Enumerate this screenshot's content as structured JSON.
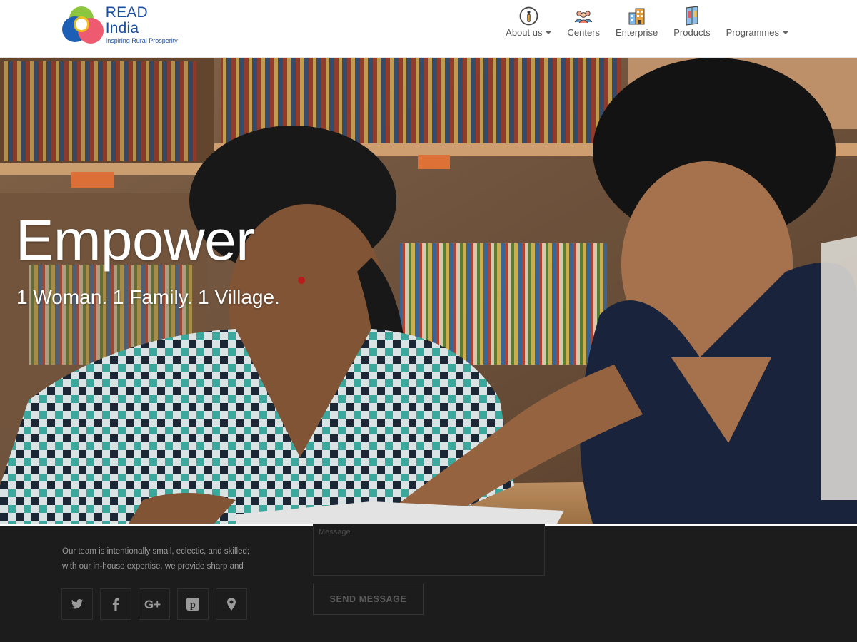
{
  "brand": {
    "name": "READ India",
    "tagline": "Inspiring Rural Prosperity"
  },
  "nav": {
    "items": [
      {
        "label": "About us",
        "icon": "info-icon",
        "dropdown": true
      },
      {
        "label": "Centers",
        "icon": "people-icon",
        "dropdown": false
      },
      {
        "label": "Enterprise",
        "icon": "buildings-icon",
        "dropdown": false
      },
      {
        "label": "Products",
        "icon": "book-icon",
        "dropdown": false
      },
      {
        "label": "Programmes",
        "icon": "",
        "dropdown": true
      }
    ]
  },
  "hero": {
    "title": "Empower",
    "subtitle": "1 Woman. 1 Family. 1 Village."
  },
  "footer": {
    "about_line1": "Our team is intentionally small, eclectic, and skilled;",
    "about_line2": "with our in-house expertise, we provide sharp and",
    "message_placeholder": "Message",
    "send_label": "SEND MESSAGE",
    "socials": [
      "twitter-icon",
      "facebook-icon",
      "google-plus-icon",
      "pinterest-icon",
      "map-pin-icon"
    ]
  },
  "colors": {
    "brand_blue": "#1b4fa3",
    "footer_bg": "#1c1c1c",
    "nav_text": "#555555"
  }
}
